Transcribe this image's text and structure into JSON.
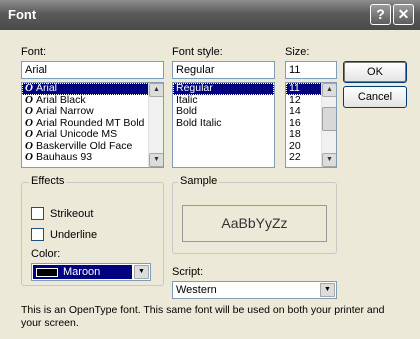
{
  "window": {
    "title": "Font",
    "help_glyph": "?",
    "close_glyph": "✕"
  },
  "font": {
    "label": "Font:",
    "value": "Arial",
    "items": [
      {
        "name": "Arial",
        "selected": true
      },
      {
        "name": "Arial Black"
      },
      {
        "name": "Arial Narrow"
      },
      {
        "name": "Arial Rounded MT Bold"
      },
      {
        "name": "Arial Unicode MS"
      },
      {
        "name": "Baskerville Old Face"
      },
      {
        "name": "Bauhaus 93"
      }
    ],
    "icon_glyph": "O"
  },
  "style": {
    "label": "Font style:",
    "value": "Regular",
    "items": [
      {
        "name": "Regular",
        "selected": true
      },
      {
        "name": "Italic"
      },
      {
        "name": "Bold"
      },
      {
        "name": "Bold Italic"
      }
    ]
  },
  "size": {
    "label": "Size:",
    "value": "11",
    "items": [
      {
        "name": "11",
        "selected": true
      },
      {
        "name": "12"
      },
      {
        "name": "14"
      },
      {
        "name": "16"
      },
      {
        "name": "18"
      },
      {
        "name": "20"
      },
      {
        "name": "22"
      }
    ]
  },
  "buttons": {
    "ok": "OK",
    "cancel": "Cancel"
  },
  "effects": {
    "title": "Effects",
    "strikeout": "Strikeout",
    "underline": "Underline",
    "color_label": "Color:",
    "color_value": "Maroon",
    "color_hex": "#000000"
  },
  "sample": {
    "title": "Sample",
    "text": "AaBbYyZz"
  },
  "script": {
    "label": "Script:",
    "value": "Western"
  },
  "description": "This is an OpenType font. This same font will be used on both your printer and your screen.",
  "scroll": {
    "up_glyph": "▲",
    "down_glyph": "▼"
  }
}
